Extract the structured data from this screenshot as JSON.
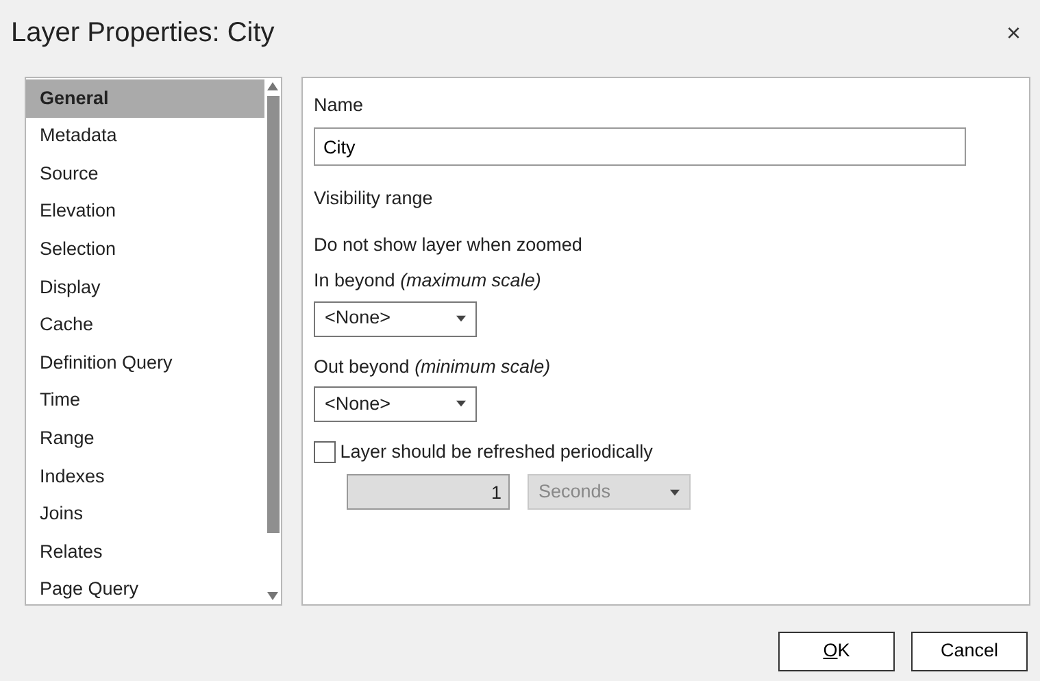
{
  "window": {
    "title": "Layer Properties: City",
    "close": "×"
  },
  "sidebar": {
    "items": [
      {
        "label": "General",
        "selected": true
      },
      {
        "label": "Metadata",
        "selected": false
      },
      {
        "label": "Source",
        "selected": false
      },
      {
        "label": "Elevation",
        "selected": false
      },
      {
        "label": "Selection",
        "selected": false
      },
      {
        "label": "Display",
        "selected": false
      },
      {
        "label": "Cache",
        "selected": false
      },
      {
        "label": "Definition Query",
        "selected": false
      },
      {
        "label": "Time",
        "selected": false
      },
      {
        "label": "Range",
        "selected": false
      },
      {
        "label": "Indexes",
        "selected": false
      },
      {
        "label": "Joins",
        "selected": false
      },
      {
        "label": "Relates",
        "selected": false
      },
      {
        "label": "Page Query",
        "selected": false
      }
    ]
  },
  "general": {
    "name_label": "Name",
    "name_value": "City",
    "visibility_heading": "Visibility range",
    "visibility_note": "Do not show layer when zoomed",
    "in_beyond": {
      "label": "In beyond *(maximum scale)*",
      "value": "<None>"
    },
    "out_beyond": {
      "label": "Out beyond *(minimum scale)*",
      "value": "<None>"
    },
    "refresh": {
      "label": "Layer should be refreshed periodically",
      "checked": false,
      "interval": "1",
      "unit": "Seconds",
      "disabled": true
    }
  },
  "buttons": [
    {
      "label": "OK",
      "mnemonic": true
    },
    {
      "label": "Cancel",
      "mnemonic": false
    }
  ]
}
